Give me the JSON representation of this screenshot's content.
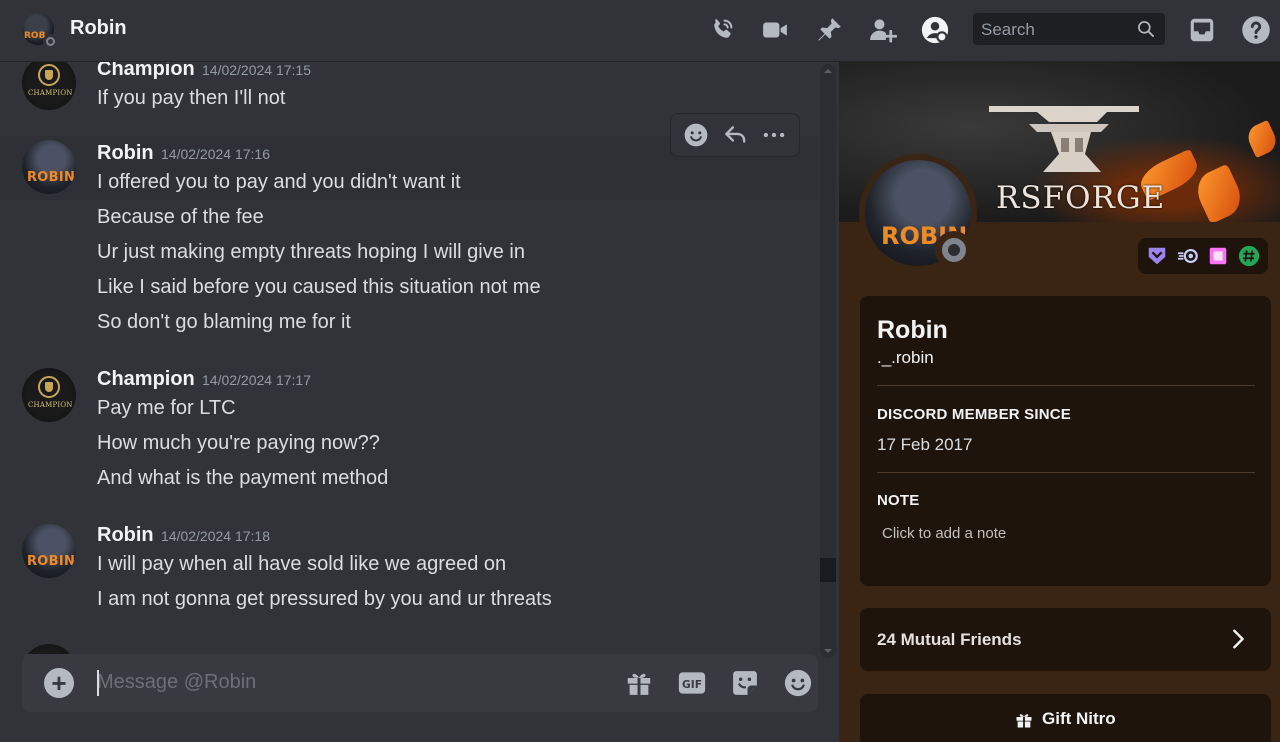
{
  "header": {
    "dm_name": "Robin",
    "search_placeholder": "Search",
    "icons": [
      "phone-call-icon",
      "video-camera-icon",
      "pin-icon",
      "add-friend-icon",
      "profile-toggle-icon",
      "search-icon",
      "inbox-icon",
      "help-icon"
    ]
  },
  "messages": [
    {
      "author": "Champion",
      "timestamp": "14/02/2024 17:15",
      "avatar_text": "CHAMPION",
      "lines": [
        "If you pay then I'll not"
      ]
    },
    {
      "author": "Robin",
      "timestamp": "14/02/2024 17:16",
      "avatar_text": "ROBIN",
      "lines": [
        "I offered you to pay and you didn't want it",
        "Because of the fee",
        "Ur just making empty threats hoping I will give in",
        "Like I said before you caused this situation not me",
        "So don't go blaming me for it"
      ]
    },
    {
      "author": "Champion",
      "timestamp": "14/02/2024 17:17",
      "avatar_text": "CHAMPION",
      "lines": [
        "Pay me for LTC",
        "How much you're paying now??",
        "And what is the payment method"
      ]
    },
    {
      "author": "Robin",
      "timestamp": "14/02/2024 17:18",
      "avatar_text": "ROBIN",
      "lines": [
        "I will pay when all have sold like we agreed on",
        "I am not gonna get pressured by you and ur threats"
      ]
    }
  ],
  "hover_actions": [
    "add-reaction-icon",
    "reply-icon",
    "more-icon"
  ],
  "composer": {
    "placeholder": "Message @Robin",
    "gif_label": "GIF",
    "icons": [
      "upload-plus-icon",
      "gift-icon",
      "gif-icon",
      "sticker-icon",
      "emoji-icon"
    ]
  },
  "profile": {
    "banner_text": "RSFORGE",
    "avatar_text": "ROBIN",
    "display_name": "Robin",
    "username": "._.robin",
    "member_since_label": "DISCORD MEMBER SINCE",
    "member_since": "17 Feb 2017",
    "note_label": "NOTE",
    "note_placeholder": "Click to add a note",
    "mutual_friends": "24 Mutual Friends",
    "gift_label": "Gift Nitro",
    "badges": [
      "hypesquad-badge-icon",
      "nitro-badge-icon",
      "boost-badge-icon",
      "active-developer-badge-icon"
    ],
    "colors": {
      "panel": "#3a2413",
      "card": "#1f140c",
      "accent": "#f08a24"
    }
  }
}
